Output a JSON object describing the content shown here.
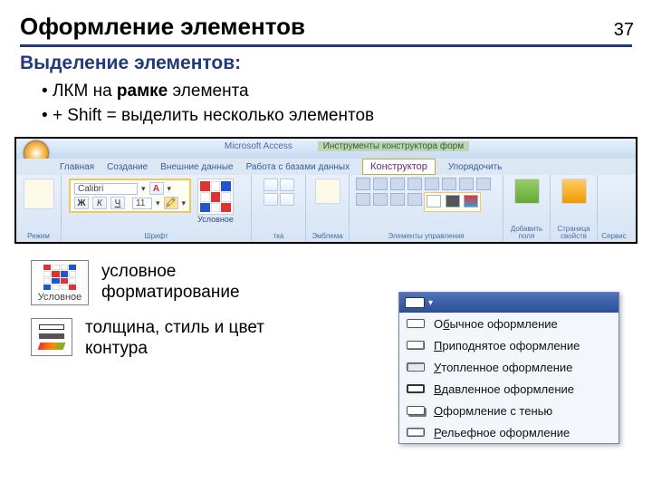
{
  "page_number": "37",
  "title": "Оформление элементов",
  "subtitle": "Выделение элементов:",
  "bullets": {
    "b1_pre": "ЛКМ на ",
    "b1_bold": "рамке",
    "b1_post": " элемента",
    "b2": "+ Shift = выделить несколько элементов"
  },
  "ribbon": {
    "app_title": "Microsoft Access",
    "context_title": "Инструменты конструктора форм",
    "tabs": {
      "home": "Главная",
      "create": "Создание",
      "external": "Внешние данные",
      "work": "Работа с базами данных",
      "constructor": "Конструктор",
      "arrange": "Упорядочить"
    },
    "font_name": "Calibri",
    "font_size": "11",
    "cond_label": "Условное",
    "groups": {
      "view": "Режим",
      "font": "Шрифт",
      "grid": "тка",
      "emblem": "Эмблема",
      "controls": "Элементы управления",
      "add_fields": "Добавить поля",
      "prop_sheet": "Страница свойств",
      "service": "Сервис"
    }
  },
  "callouts": {
    "cond_btn_label": "Условное",
    "cond_caption": "условное форматирование",
    "line_caption": "толщина, стиль и цвет контура"
  },
  "dropdown": {
    "items": [
      {
        "pre": "О",
        "u": "б",
        "post": "ычное оформление"
      },
      {
        "pre": "",
        "u": "П",
        "post": "риподнятое оформление"
      },
      {
        "pre": "",
        "u": "У",
        "post": "топленное оформление"
      },
      {
        "pre": "",
        "u": "В",
        "post": "давленное оформление"
      },
      {
        "pre": "",
        "u": "О",
        "post": "формление с тенью"
      },
      {
        "pre": "",
        "u": "Р",
        "post": "ельефное оформление"
      }
    ]
  }
}
